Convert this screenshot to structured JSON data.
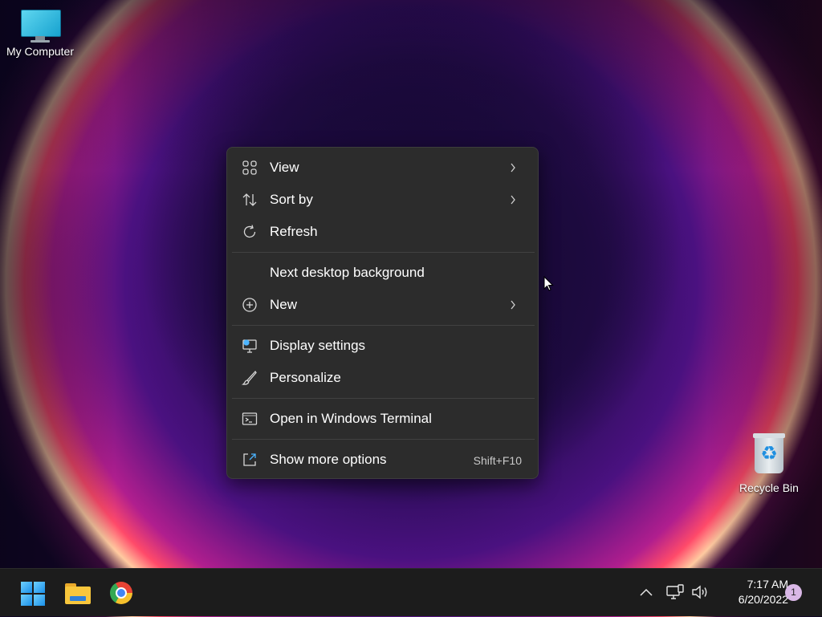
{
  "desktop": {
    "icons": [
      {
        "label": "My Computer"
      },
      {
        "label": "Recycle Bin"
      }
    ]
  },
  "context_menu": {
    "items": [
      {
        "label": "View",
        "icon": "grid-view-icon",
        "submenu": true
      },
      {
        "label": "Sort by",
        "icon": "sort-arrows-icon",
        "submenu": true
      },
      {
        "label": "Refresh",
        "icon": "refresh-icon",
        "submenu": false
      },
      {
        "label": "Next desktop background",
        "icon": "",
        "submenu": false
      },
      {
        "label": "New",
        "icon": "plus-circle-icon",
        "submenu": true
      },
      {
        "label": "Display settings",
        "icon": "display-settings-icon",
        "submenu": false
      },
      {
        "label": "Personalize",
        "icon": "brush-icon",
        "submenu": false
      },
      {
        "label": "Open in Windows Terminal",
        "icon": "terminal-icon",
        "submenu": false
      },
      {
        "label": "Show more options",
        "icon": "open-external-icon",
        "submenu": false,
        "shortcut": "Shift+F10"
      }
    ]
  },
  "taskbar": {
    "apps": [
      {
        "name": "Start",
        "icon": "windows-start-icon"
      },
      {
        "name": "File Explorer",
        "icon": "folder-icon"
      },
      {
        "name": "Google Chrome",
        "icon": "chrome-icon"
      }
    ],
    "tray": {
      "icons": [
        "chevron-up-icon",
        "network-icon",
        "volume-icon"
      ],
      "time": "7:17 AM",
      "date": "6/20/2022",
      "notification_count": "1"
    }
  },
  "colors": {
    "menu_bg": "#2c2c2c",
    "taskbar_bg": "#1c1c1c",
    "accent": "#1a8fe8"
  }
}
